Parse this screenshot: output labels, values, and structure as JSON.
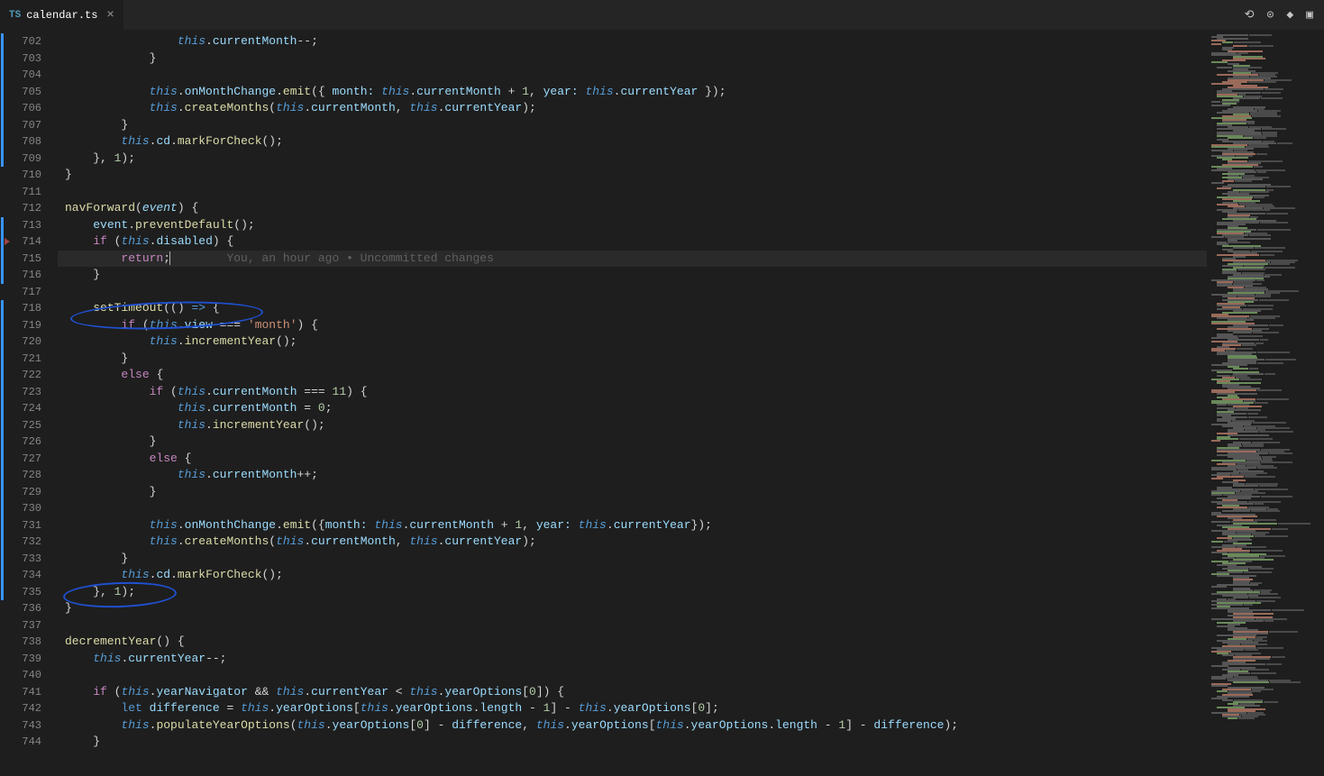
{
  "tab": {
    "icon": "TS",
    "filename": "calendar.ts",
    "close": "×"
  },
  "toolbar": {
    "icons": [
      "compare-icon",
      "preview-icon",
      "run-icon",
      "split-icon"
    ]
  },
  "blame": {
    "text": "You, an hour ago • Uncommitted changes"
  },
  "lines": [
    {
      "n": 702,
      "mod": true,
      "segs": [
        {
          "t": "                ",
          "c": ""
        },
        {
          "t": "this",
          "c": "thisref"
        },
        {
          "t": ".",
          "c": ""
        },
        {
          "t": "currentMonth",
          "c": "prop"
        },
        {
          "t": "--;",
          "c": ""
        }
      ]
    },
    {
      "n": 703,
      "mod": true,
      "segs": [
        {
          "t": "            }",
          "c": ""
        }
      ]
    },
    {
      "n": 704,
      "mod": true,
      "segs": [
        {
          "t": "",
          "c": ""
        }
      ]
    },
    {
      "n": 705,
      "mod": true,
      "segs": [
        {
          "t": "            ",
          "c": ""
        },
        {
          "t": "this",
          "c": "thisref"
        },
        {
          "t": ".",
          "c": ""
        },
        {
          "t": "onMonthChange",
          "c": "prop"
        },
        {
          "t": ".",
          "c": ""
        },
        {
          "t": "emit",
          "c": "propmeth"
        },
        {
          "t": "({ ",
          "c": ""
        },
        {
          "t": "month:",
          "c": "prop"
        },
        {
          "t": " ",
          "c": ""
        },
        {
          "t": "this",
          "c": "thisref"
        },
        {
          "t": ".",
          "c": ""
        },
        {
          "t": "currentMonth",
          "c": "prop"
        },
        {
          "t": " + ",
          "c": ""
        },
        {
          "t": "1",
          "c": "num"
        },
        {
          "t": ", ",
          "c": ""
        },
        {
          "t": "year:",
          "c": "prop"
        },
        {
          "t": " ",
          "c": ""
        },
        {
          "t": "this",
          "c": "thisref"
        },
        {
          "t": ".",
          "c": ""
        },
        {
          "t": "currentYear",
          "c": "prop"
        },
        {
          "t": " });",
          "c": ""
        }
      ]
    },
    {
      "n": 706,
      "mod": true,
      "segs": [
        {
          "t": "            ",
          "c": ""
        },
        {
          "t": "this",
          "c": "thisref"
        },
        {
          "t": ".",
          "c": ""
        },
        {
          "t": "createMonths",
          "c": "propmeth"
        },
        {
          "t": "(",
          "c": ""
        },
        {
          "t": "this",
          "c": "thisref"
        },
        {
          "t": ".",
          "c": ""
        },
        {
          "t": "currentMonth",
          "c": "prop"
        },
        {
          "t": ", ",
          "c": ""
        },
        {
          "t": "this",
          "c": "thisref"
        },
        {
          "t": ".",
          "c": ""
        },
        {
          "t": "currentYear",
          "c": "prop"
        },
        {
          "t": ");",
          "c": ""
        }
      ]
    },
    {
      "n": 707,
      "mod": true,
      "segs": [
        {
          "t": "        }",
          "c": ""
        }
      ]
    },
    {
      "n": 708,
      "mod": true,
      "segs": [
        {
          "t": "        ",
          "c": ""
        },
        {
          "t": "this",
          "c": "thisref"
        },
        {
          "t": ".",
          "c": ""
        },
        {
          "t": "cd",
          "c": "prop"
        },
        {
          "t": ".",
          "c": ""
        },
        {
          "t": "markForCheck",
          "c": "propmeth"
        },
        {
          "t": "();",
          "c": ""
        }
      ]
    },
    {
      "n": 709,
      "mod": true,
      "segs": [
        {
          "t": "    }, ",
          "c": ""
        },
        {
          "t": "1",
          "c": "num"
        },
        {
          "t": ");",
          "c": ""
        }
      ]
    },
    {
      "n": 710,
      "mod": false,
      "segs": [
        {
          "t": "}",
          "c": ""
        }
      ]
    },
    {
      "n": 711,
      "mod": false,
      "segs": [
        {
          "t": "",
          "c": ""
        }
      ]
    },
    {
      "n": 712,
      "mod": false,
      "segs": [
        {
          "t": "navForward",
          "c": "propmeth"
        },
        {
          "t": "(",
          "c": ""
        },
        {
          "t": "event",
          "c": "param"
        },
        {
          "t": ") {",
          "c": ""
        }
      ]
    },
    {
      "n": 713,
      "mod": true,
      "segs": [
        {
          "t": "    ",
          "c": ""
        },
        {
          "t": "event",
          "c": "prop"
        },
        {
          "t": ".",
          "c": ""
        },
        {
          "t": "preventDefault",
          "c": "propmeth"
        },
        {
          "t": "();",
          "c": ""
        }
      ]
    },
    {
      "n": 714,
      "mod": true,
      "segs": [
        {
          "t": "    ",
          "c": ""
        },
        {
          "t": "if",
          "c": "kw"
        },
        {
          "t": " (",
          "c": ""
        },
        {
          "t": "this",
          "c": "thisref"
        },
        {
          "t": ".",
          "c": ""
        },
        {
          "t": "disabled",
          "c": "prop"
        },
        {
          "t": ") {",
          "c": ""
        }
      ]
    },
    {
      "n": 715,
      "mod": true,
      "current": true,
      "blame": true,
      "segs": [
        {
          "t": "        ",
          "c": ""
        },
        {
          "t": "return",
          "c": "kw"
        },
        {
          "t": ";",
          "c": ""
        }
      ]
    },
    {
      "n": 716,
      "mod": true,
      "segs": [
        {
          "t": "    }",
          "c": ""
        }
      ]
    },
    {
      "n": 717,
      "mod": false,
      "segs": [
        {
          "t": "",
          "c": ""
        }
      ]
    },
    {
      "n": 718,
      "mod": true,
      "segs": [
        {
          "t": "    ",
          "c": ""
        },
        {
          "t": "setTimeout",
          "c": "propmeth"
        },
        {
          "t": "(() ",
          "c": ""
        },
        {
          "t": "=>",
          "c": "kw2"
        },
        {
          "t": " {",
          "c": ""
        }
      ]
    },
    {
      "n": 719,
      "mod": true,
      "segs": [
        {
          "t": "        ",
          "c": ""
        },
        {
          "t": "if",
          "c": "kw"
        },
        {
          "t": " (",
          "c": ""
        },
        {
          "t": "this",
          "c": "thisref"
        },
        {
          "t": ".",
          "c": ""
        },
        {
          "t": "view",
          "c": "prop"
        },
        {
          "t": " === ",
          "c": ""
        },
        {
          "t": "'month'",
          "c": "str"
        },
        {
          "t": ") {",
          "c": ""
        }
      ]
    },
    {
      "n": 720,
      "mod": true,
      "segs": [
        {
          "t": "            ",
          "c": ""
        },
        {
          "t": "this",
          "c": "thisref"
        },
        {
          "t": ".",
          "c": ""
        },
        {
          "t": "incrementYear",
          "c": "propmeth"
        },
        {
          "t": "();",
          "c": ""
        }
      ]
    },
    {
      "n": 721,
      "mod": true,
      "segs": [
        {
          "t": "        }",
          "c": ""
        }
      ]
    },
    {
      "n": 722,
      "mod": true,
      "segs": [
        {
          "t": "        ",
          "c": ""
        },
        {
          "t": "else",
          "c": "kw"
        },
        {
          "t": " {",
          "c": ""
        }
      ]
    },
    {
      "n": 723,
      "mod": true,
      "segs": [
        {
          "t": "            ",
          "c": ""
        },
        {
          "t": "if",
          "c": "kw"
        },
        {
          "t": " (",
          "c": ""
        },
        {
          "t": "this",
          "c": "thisref"
        },
        {
          "t": ".",
          "c": ""
        },
        {
          "t": "currentMonth",
          "c": "prop"
        },
        {
          "t": " === ",
          "c": ""
        },
        {
          "t": "11",
          "c": "num"
        },
        {
          "t": ") {",
          "c": ""
        }
      ]
    },
    {
      "n": 724,
      "mod": true,
      "segs": [
        {
          "t": "                ",
          "c": ""
        },
        {
          "t": "this",
          "c": "thisref"
        },
        {
          "t": ".",
          "c": ""
        },
        {
          "t": "currentMonth",
          "c": "prop"
        },
        {
          "t": " = ",
          "c": ""
        },
        {
          "t": "0",
          "c": "num"
        },
        {
          "t": ";",
          "c": ""
        }
      ]
    },
    {
      "n": 725,
      "mod": true,
      "segs": [
        {
          "t": "                ",
          "c": ""
        },
        {
          "t": "this",
          "c": "thisref"
        },
        {
          "t": ".",
          "c": ""
        },
        {
          "t": "incrementYear",
          "c": "propmeth"
        },
        {
          "t": "();",
          "c": ""
        }
      ]
    },
    {
      "n": 726,
      "mod": true,
      "segs": [
        {
          "t": "            }",
          "c": ""
        }
      ]
    },
    {
      "n": 727,
      "mod": true,
      "segs": [
        {
          "t": "            ",
          "c": ""
        },
        {
          "t": "else",
          "c": "kw"
        },
        {
          "t": " {",
          "c": ""
        }
      ]
    },
    {
      "n": 728,
      "mod": true,
      "segs": [
        {
          "t": "                ",
          "c": ""
        },
        {
          "t": "this",
          "c": "thisref"
        },
        {
          "t": ".",
          "c": ""
        },
        {
          "t": "currentMonth",
          "c": "prop"
        },
        {
          "t": "++;",
          "c": ""
        }
      ]
    },
    {
      "n": 729,
      "mod": true,
      "segs": [
        {
          "t": "            }",
          "c": ""
        }
      ]
    },
    {
      "n": 730,
      "mod": true,
      "segs": [
        {
          "t": "",
          "c": ""
        }
      ]
    },
    {
      "n": 731,
      "mod": true,
      "segs": [
        {
          "t": "            ",
          "c": ""
        },
        {
          "t": "this",
          "c": "thisref"
        },
        {
          "t": ".",
          "c": ""
        },
        {
          "t": "onMonthChange",
          "c": "prop"
        },
        {
          "t": ".",
          "c": ""
        },
        {
          "t": "emit",
          "c": "propmeth"
        },
        {
          "t": "({",
          "c": ""
        },
        {
          "t": "month:",
          "c": "prop"
        },
        {
          "t": " ",
          "c": ""
        },
        {
          "t": "this",
          "c": "thisref"
        },
        {
          "t": ".",
          "c": ""
        },
        {
          "t": "currentMonth",
          "c": "prop"
        },
        {
          "t": " + ",
          "c": ""
        },
        {
          "t": "1",
          "c": "num"
        },
        {
          "t": ", ",
          "c": ""
        },
        {
          "t": "year:",
          "c": "prop"
        },
        {
          "t": " ",
          "c": ""
        },
        {
          "t": "this",
          "c": "thisref"
        },
        {
          "t": ".",
          "c": ""
        },
        {
          "t": "currentYear",
          "c": "prop"
        },
        {
          "t": "});",
          "c": ""
        }
      ]
    },
    {
      "n": 732,
      "mod": true,
      "segs": [
        {
          "t": "            ",
          "c": ""
        },
        {
          "t": "this",
          "c": "thisref"
        },
        {
          "t": ".",
          "c": ""
        },
        {
          "t": "createMonths",
          "c": "propmeth"
        },
        {
          "t": "(",
          "c": ""
        },
        {
          "t": "this",
          "c": "thisref"
        },
        {
          "t": ".",
          "c": ""
        },
        {
          "t": "currentMonth",
          "c": "prop"
        },
        {
          "t": ", ",
          "c": ""
        },
        {
          "t": "this",
          "c": "thisref"
        },
        {
          "t": ".",
          "c": ""
        },
        {
          "t": "currentYear",
          "c": "prop"
        },
        {
          "t": ");",
          "c": ""
        }
      ]
    },
    {
      "n": 733,
      "mod": true,
      "segs": [
        {
          "t": "        }",
          "c": ""
        }
      ]
    },
    {
      "n": 734,
      "mod": true,
      "segs": [
        {
          "t": "        ",
          "c": ""
        },
        {
          "t": "this",
          "c": "thisref"
        },
        {
          "t": ".",
          "c": ""
        },
        {
          "t": "cd",
          "c": "prop"
        },
        {
          "t": ".",
          "c": ""
        },
        {
          "t": "markForCheck",
          "c": "propmeth"
        },
        {
          "t": "();",
          "c": ""
        }
      ]
    },
    {
      "n": 735,
      "mod": true,
      "segs": [
        {
          "t": "    }, ",
          "c": ""
        },
        {
          "t": "1",
          "c": "num"
        },
        {
          "t": ");",
          "c": ""
        }
      ]
    },
    {
      "n": 736,
      "mod": false,
      "segs": [
        {
          "t": "}",
          "c": ""
        }
      ]
    },
    {
      "n": 737,
      "mod": false,
      "segs": [
        {
          "t": "",
          "c": ""
        }
      ]
    },
    {
      "n": 738,
      "mod": false,
      "segs": [
        {
          "t": "decrementYear",
          "c": "propmeth"
        },
        {
          "t": "() {",
          "c": ""
        }
      ]
    },
    {
      "n": 739,
      "mod": false,
      "segs": [
        {
          "t": "    ",
          "c": ""
        },
        {
          "t": "this",
          "c": "thisref"
        },
        {
          "t": ".",
          "c": ""
        },
        {
          "t": "currentYear",
          "c": "prop"
        },
        {
          "t": "--;",
          "c": ""
        }
      ]
    },
    {
      "n": 740,
      "mod": false,
      "segs": [
        {
          "t": "",
          "c": ""
        }
      ]
    },
    {
      "n": 741,
      "mod": false,
      "segs": [
        {
          "t": "    ",
          "c": ""
        },
        {
          "t": "if",
          "c": "kw"
        },
        {
          "t": " (",
          "c": ""
        },
        {
          "t": "this",
          "c": "thisref"
        },
        {
          "t": ".",
          "c": ""
        },
        {
          "t": "yearNavigator",
          "c": "prop"
        },
        {
          "t": " && ",
          "c": ""
        },
        {
          "t": "this",
          "c": "thisref"
        },
        {
          "t": ".",
          "c": ""
        },
        {
          "t": "currentYear",
          "c": "prop"
        },
        {
          "t": " < ",
          "c": ""
        },
        {
          "t": "this",
          "c": "thisref"
        },
        {
          "t": ".",
          "c": ""
        },
        {
          "t": "yearOptions",
          "c": "prop"
        },
        {
          "t": "[",
          "c": ""
        },
        {
          "t": "0",
          "c": "num"
        },
        {
          "t": "]) {",
          "c": ""
        }
      ]
    },
    {
      "n": 742,
      "mod": false,
      "segs": [
        {
          "t": "        ",
          "c": ""
        },
        {
          "t": "let",
          "c": "kw2"
        },
        {
          "t": " ",
          "c": ""
        },
        {
          "t": "difference",
          "c": "prop"
        },
        {
          "t": " = ",
          "c": ""
        },
        {
          "t": "this",
          "c": "thisref"
        },
        {
          "t": ".",
          "c": ""
        },
        {
          "t": "yearOptions",
          "c": "prop"
        },
        {
          "t": "[",
          "c": ""
        },
        {
          "t": "this",
          "c": "thisref"
        },
        {
          "t": ".",
          "c": ""
        },
        {
          "t": "yearOptions",
          "c": "prop"
        },
        {
          "t": ".",
          "c": ""
        },
        {
          "t": "length",
          "c": "prop"
        },
        {
          "t": " - ",
          "c": ""
        },
        {
          "t": "1",
          "c": "num"
        },
        {
          "t": "] - ",
          "c": ""
        },
        {
          "t": "this",
          "c": "thisref"
        },
        {
          "t": ".",
          "c": ""
        },
        {
          "t": "yearOptions",
          "c": "prop"
        },
        {
          "t": "[",
          "c": ""
        },
        {
          "t": "0",
          "c": "num"
        },
        {
          "t": "];",
          "c": ""
        }
      ]
    },
    {
      "n": 743,
      "mod": false,
      "segs": [
        {
          "t": "        ",
          "c": ""
        },
        {
          "t": "this",
          "c": "thisref"
        },
        {
          "t": ".",
          "c": ""
        },
        {
          "t": "populateYearOptions",
          "c": "propmeth"
        },
        {
          "t": "(",
          "c": ""
        },
        {
          "t": "this",
          "c": "thisref"
        },
        {
          "t": ".",
          "c": ""
        },
        {
          "t": "yearOptions",
          "c": "prop"
        },
        {
          "t": "[",
          "c": ""
        },
        {
          "t": "0",
          "c": "num"
        },
        {
          "t": "] - ",
          "c": ""
        },
        {
          "t": "difference",
          "c": "prop"
        },
        {
          "t": ", ",
          "c": ""
        },
        {
          "t": "this",
          "c": "thisref"
        },
        {
          "t": ".",
          "c": ""
        },
        {
          "t": "yearOptions",
          "c": "prop"
        },
        {
          "t": "[",
          "c": ""
        },
        {
          "t": "this",
          "c": "thisref"
        },
        {
          "t": ".",
          "c": ""
        },
        {
          "t": "yearOptions",
          "c": "prop"
        },
        {
          "t": ".",
          "c": ""
        },
        {
          "t": "length",
          "c": "prop"
        },
        {
          "t": " - ",
          "c": ""
        },
        {
          "t": "1",
          "c": "num"
        },
        {
          "t": "] - ",
          "c": ""
        },
        {
          "t": "difference",
          "c": "prop"
        },
        {
          "t": ");",
          "c": ""
        }
      ]
    },
    {
      "n": 744,
      "mod": false,
      "segs": [
        {
          "t": "    }",
          "c": ""
        }
      ]
    }
  ]
}
